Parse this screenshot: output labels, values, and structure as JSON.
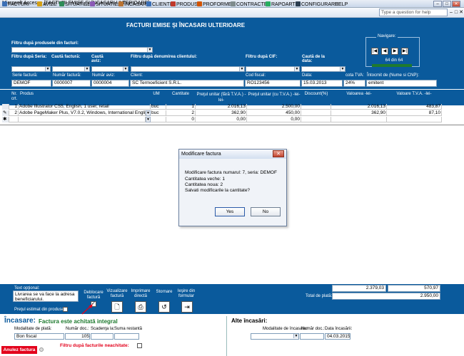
{
  "window": {
    "title": "Microsoft Access - [FACTURI EMISE ŞI ÎNCASARI ULTERIOARE]",
    "help_placeholder": "Type a question for help"
  },
  "menu": [
    {
      "label": "FACTURI",
      "icon": "invoices-icon",
      "color": "#3b6fb5"
    },
    {
      "label": "AVIZE",
      "icon": "notes-icon",
      "color": "#d4a017"
    },
    {
      "label": "SITUATIE1",
      "icon": "report1-icon",
      "color": "#2e8b57"
    },
    {
      "label": "SITUATIE2",
      "icon": "report2-icon",
      "color": "#8a5ab5"
    },
    {
      "label": "ÎNCASARI",
      "icon": "cash-icon",
      "color": "#b87333"
    },
    {
      "label": "CLIENTI",
      "icon": "clients-icon",
      "color": "#3b6fb5"
    },
    {
      "label": "PRODUSE",
      "icon": "products-icon",
      "color": "#c0392b"
    },
    {
      "label": "PROFORME",
      "icon": "proforma-icon",
      "color": "#d35400"
    },
    {
      "label": "CONTRACTE",
      "icon": "contracts-icon",
      "color": "#7f8c8d"
    },
    {
      "label": "RAPOARTE",
      "icon": "reports-icon",
      "color": "#27ae60"
    },
    {
      "label": "CONFIGURARE",
      "icon": "config-icon",
      "color": "#2c3e50"
    },
    {
      "label": "HELP",
      "icon": "",
      "color": ""
    }
  ],
  "form": {
    "title": "FACTURI EMISE ŞI ÎNCASARI ULTERIOARE",
    "filter_products_label": "Filtru după produsele din facturi:",
    "filter_series_label": "Filtru după Seria:",
    "search_invoice_label": "Caută factură:",
    "search_note_label": "Caută aviz:",
    "filter_client_label": "Filtru după denumirea clientului:",
    "filter_cif_label": "Filtru după CIF:",
    "search_date_label": "Caută de la data:",
    "navigation": {
      "title": "Navigare:",
      "current": 64,
      "of_label": "din",
      "total": 64,
      "progress": 1.0
    },
    "fields": {
      "series_label": "Serie factură:",
      "series": "DEMOF",
      "invoice_no_label": "Număr factură:",
      "invoice_no": "0000007",
      "note_no_label": "Număr aviz:",
      "note_no": "0000004",
      "client_label": "Client:",
      "client": "SC Termoeficient S.R.L.",
      "cif_label": "Cod fiscal:",
      "cif": "RO123456",
      "date_label": "Data:",
      "date": "15.03.2013",
      "vat_label": "cota TVA:",
      "vat": "24%",
      "issued_label": "Întocmit de (Nume si CNP):",
      "issued": "emitent"
    }
  },
  "grid": {
    "headers": [
      "Nr. crt.",
      "Produs",
      "UM",
      "Cantitate",
      "Preţul unitar (fără T.V.A.) -lei-",
      "Preţul unitar (cu T.V.A.) -lei-",
      "Discount(%)",
      "Valoarea -lei-",
      "Valoare T.V.A. -lei-"
    ],
    "rows": [
      {
        "marker": "",
        "nr": "1",
        "product": "Adobe Illustrator CS5, English, 1 user, retail",
        "um": "buc",
        "qty": "1",
        "price": "2.016,13",
        "price_vat": "2.500,00",
        "discount": "",
        "value": "2.016,13",
        "vat_value": "483,87"
      },
      {
        "marker": "✎",
        "nr": "2",
        "product": "Adobe PageMaker Plus, V7.0.2, Windows, International English",
        "um": "buc",
        "qty": "2",
        "price": "362,90",
        "price_vat": "450,00",
        "discount": "",
        "value": "362,90",
        "vat_value": "87,10"
      },
      {
        "marker": "✱",
        "nr": "",
        "product": "",
        "um": "",
        "qty": "0",
        "price": "0,00",
        "price_vat": "0,00",
        "discount": "",
        "value": "",
        "vat_value": ""
      }
    ]
  },
  "footer": {
    "optional_text_label": "Text opţional:",
    "optional_text": "Livrarea se va face la adresa beneficiarului.",
    "estimated_price_label": "Preţul estimat din produse",
    "unlock_label": "Deblocare factură",
    "view_label": "Vizualizare factură",
    "print_label": "Imprimare directă",
    "cancel_label": "Stornare",
    "exit_label": "Ieşire din formular",
    "total_value": "2.379,03",
    "total_vat": "570,97",
    "total_pay_label": "Total de plată:",
    "total_pay": "2.950,00"
  },
  "payments": {
    "title": "Încasare:",
    "status": "Factura este achitată integral",
    "columns": [
      "Modalitate de plată:",
      "Număr doc.:",
      "Scadenţa la:",
      "Suma restantă"
    ],
    "row": {
      "method": "Bon fiscal",
      "doc": "105",
      "due": "",
      "rest": ""
    },
    "filter_unpaid_label": "Filtru după facturile neachitate:",
    "other_title": "Alte încasări:",
    "other_columns": [
      "Modalitate de încasare:",
      "Număr doc.:",
      "Data încasării:"
    ],
    "other_row": {
      "method": "",
      "doc": "",
      "date": "04.03.2015"
    },
    "cancel_invoice_label": "Anulez factura"
  },
  "dialog": {
    "title": "Modificare factura",
    "line1": "Modificare factura numarul: 7, seria: DEMOF",
    "line2": "Cantitatea veche: 1",
    "line3": "Cantitatea noua: 2",
    "line4": "Salvati modificarile la cantitate?",
    "yes": "Yes",
    "no": "No"
  },
  "colors": {
    "form_blue": "#0a5a9c",
    "status_green": "#1e7a2e",
    "alert_red": "#e3001b"
  }
}
